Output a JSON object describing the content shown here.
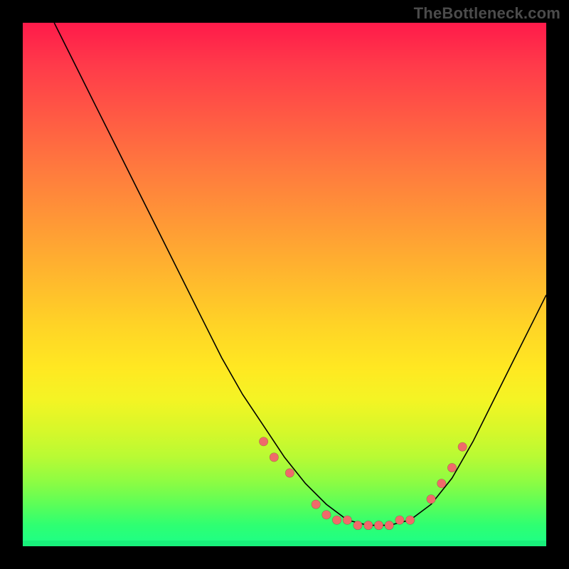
{
  "watermark_text": "TheBottleneck.com",
  "colors": {
    "frame_bg": "#000000",
    "curve": "#000000",
    "dot_fill": "#ef6a6a",
    "gradient_top": "#ff1a4a",
    "gradient_bottom": "#18f07a"
  },
  "chart_data": {
    "type": "line",
    "title": "",
    "xlabel": "",
    "ylabel": "",
    "xlim": [
      0,
      100
    ],
    "ylim": [
      0,
      100
    ],
    "curve": {
      "x": [
        6,
        10,
        14,
        18,
        22,
        26,
        30,
        34,
        38,
        42,
        46,
        50,
        54,
        58,
        62,
        66,
        70,
        74,
        78,
        82,
        86,
        90,
        94,
        98,
        100
      ],
      "y": [
        100,
        92,
        84,
        76,
        68,
        60,
        52,
        44,
        36,
        29,
        23,
        17,
        12,
        8,
        5,
        4,
        4,
        5,
        8,
        13,
        20,
        28,
        36,
        44,
        48
      ]
    },
    "dots": {
      "x": [
        46,
        48,
        51,
        56,
        58,
        60,
        62,
        64,
        66,
        68,
        70,
        72,
        74,
        78,
        80,
        82,
        84
      ],
      "y": [
        20,
        17,
        14,
        8,
        6,
        5,
        5,
        4,
        4,
        4,
        4,
        5,
        5,
        9,
        12,
        15,
        19
      ]
    }
  }
}
